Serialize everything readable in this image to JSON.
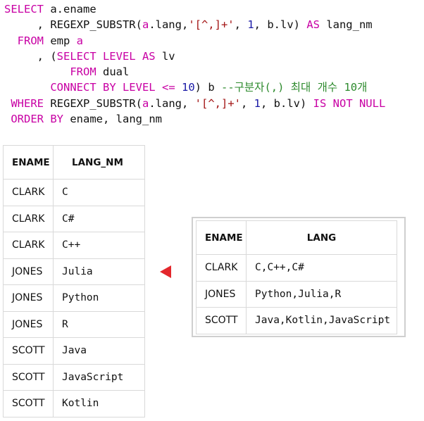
{
  "colors": {
    "keyword": "#c800a4",
    "number": "#1a1aa6",
    "string": "#a31515",
    "comment": "#2e8b2e",
    "arrow": "#e3272c",
    "grid_border": "#d9d9d9"
  },
  "code_lines": [
    [
      [
        "kw",
        "SELECT "
      ],
      [
        "id",
        "a.ename"
      ]
    ],
    [
      [
        "id",
        "     , REGEXP_SUBSTR("
      ],
      [
        "kw",
        "a"
      ],
      [
        "id",
        ".lang,"
      ],
      [
        "str",
        "'[^,]+'"
      ],
      [
        "id",
        ", "
      ],
      [
        "num",
        "1"
      ],
      [
        "id",
        ", b.lv) "
      ],
      [
        "kw",
        "AS"
      ],
      [
        "id",
        " lang_nm"
      ]
    ],
    [
      [
        "kw",
        "  FROM"
      ],
      [
        "id",
        " emp "
      ],
      [
        "kw",
        "a"
      ]
    ],
    [
      [
        "id",
        "     , ("
      ],
      [
        "kw",
        "SELECT LEVEL AS"
      ],
      [
        "id",
        " lv"
      ]
    ],
    [
      [
        "id",
        "          "
      ],
      [
        "kw",
        "FROM"
      ],
      [
        "id",
        " dual"
      ]
    ],
    [
      [
        "id",
        "       "
      ],
      [
        "kw",
        "CONNECT BY LEVEL"
      ],
      [
        "id",
        " "
      ],
      [
        "kw",
        "<="
      ],
      [
        "id",
        " "
      ],
      [
        "num",
        "10"
      ],
      [
        "id",
        ") b "
      ],
      [
        "cm",
        "--구분자(,) 최대 개수 10개"
      ]
    ],
    [
      [
        "kw",
        " WHERE"
      ],
      [
        "id",
        " REGEXP_SUBSTR("
      ],
      [
        "kw",
        "a"
      ],
      [
        "id",
        ".lang, "
      ],
      [
        "str",
        "'[^,]+'"
      ],
      [
        "id",
        ", "
      ],
      [
        "num",
        "1"
      ],
      [
        "id",
        ", b.lv) "
      ],
      [
        "kw",
        "IS NOT NULL"
      ]
    ],
    [
      [
        "kw",
        " ORDER BY"
      ],
      [
        "id",
        " ename, lang_nm"
      ]
    ]
  ],
  "left_table": {
    "headers": [
      "ENAME",
      "LANG_NM"
    ],
    "rows": [
      [
        "CLARK",
        "C"
      ],
      [
        "CLARK",
        "C#"
      ],
      [
        "CLARK",
        "C++"
      ],
      [
        "JONES",
        "Julia"
      ],
      [
        "JONES",
        "Python"
      ],
      [
        "JONES",
        "R"
      ],
      [
        "SCOTT",
        "Java"
      ],
      [
        "SCOTT",
        "JavaScript"
      ],
      [
        "SCOTT",
        "Kotlin"
      ]
    ]
  },
  "right_table": {
    "headers": [
      "ENAME",
      "LANG"
    ],
    "rows": [
      [
        "CLARK",
        "C,C++,C#"
      ],
      [
        "JONES",
        "Python,Julia,R"
      ],
      [
        "SCOTT",
        "Java,Kotlin,JavaScript"
      ]
    ]
  },
  "arrow_icon": "triangle-left-icon"
}
